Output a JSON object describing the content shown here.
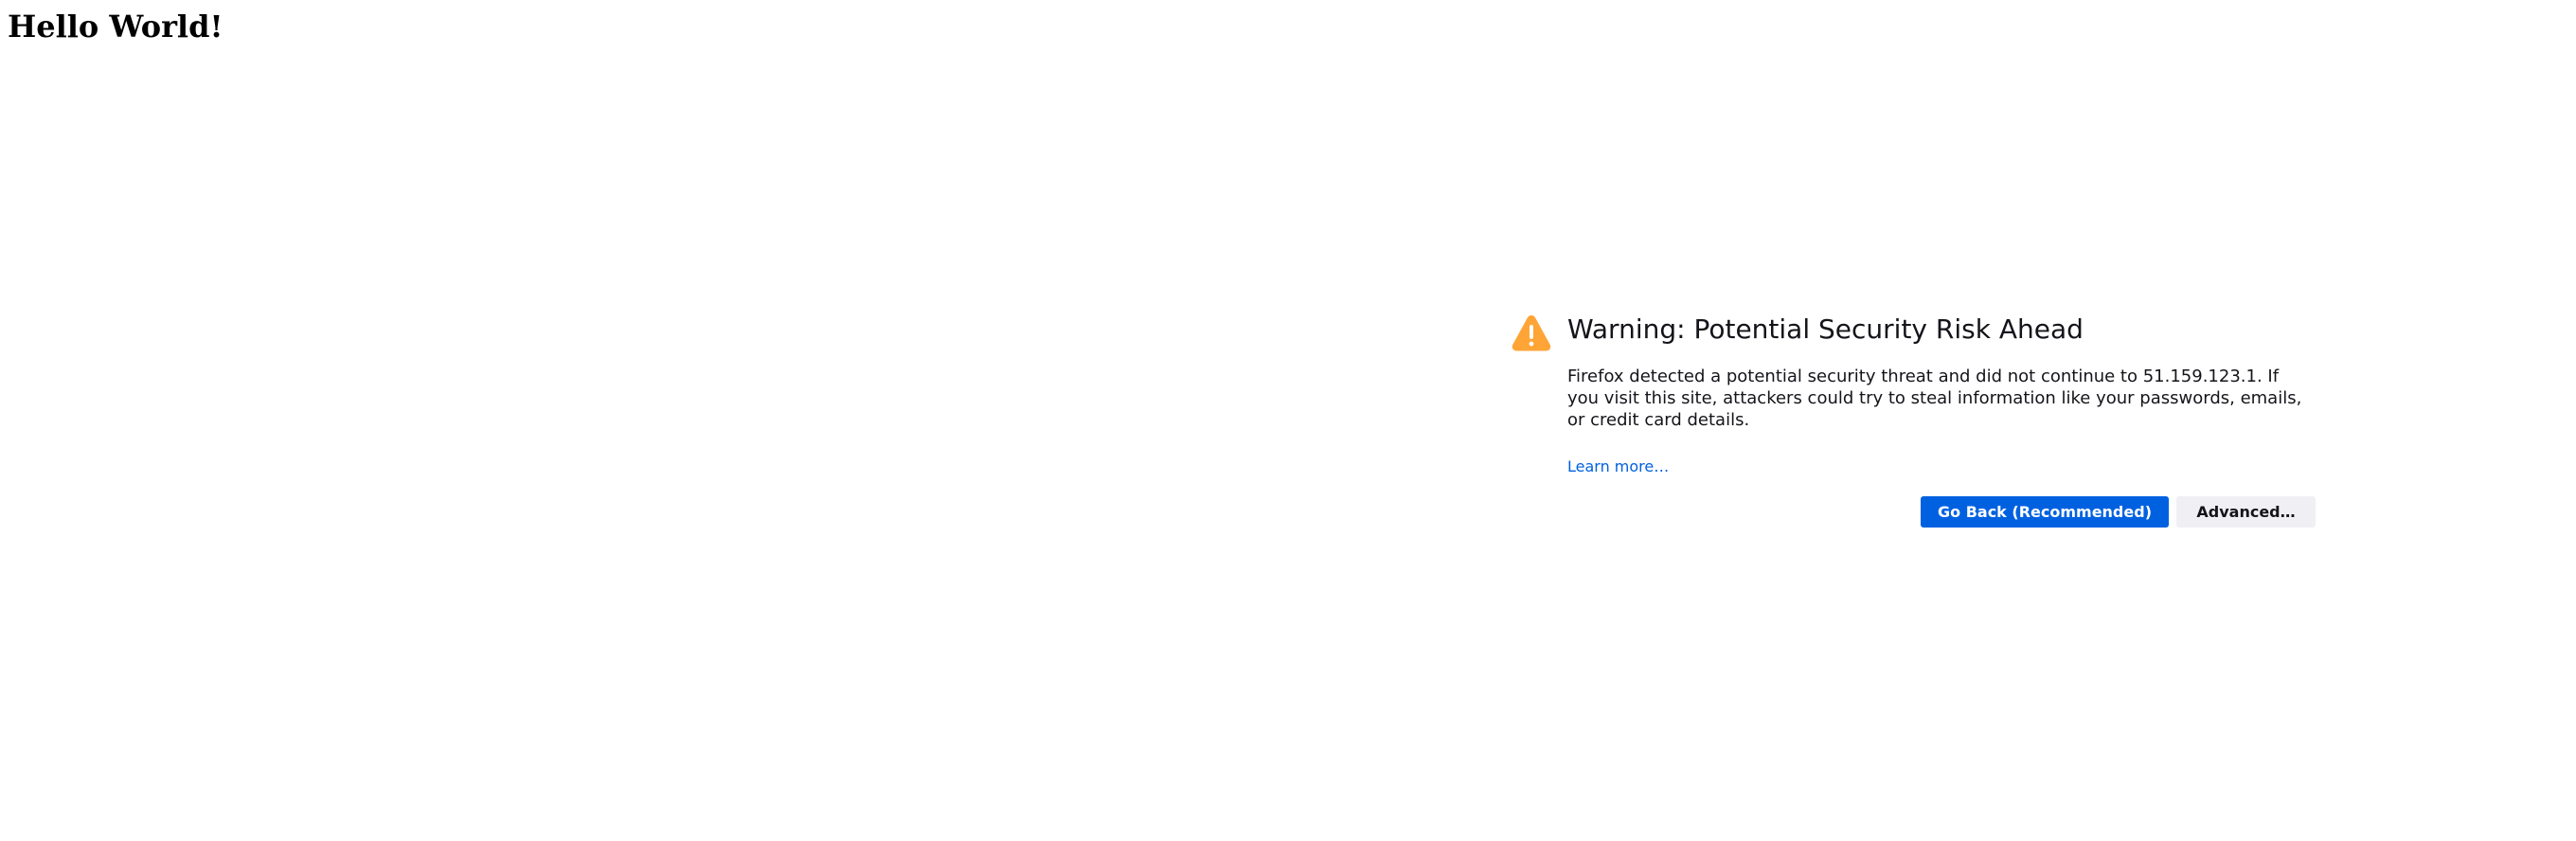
{
  "page": {
    "heading": "Hello World!"
  },
  "warning": {
    "icon": "warning-triangle-icon",
    "accent_color": "#ffa436",
    "title": "Warning: Potential Security Risk Ahead",
    "text": "Firefox detected a potential security threat and did not continue to 51.159.123.1. If you visit this site, attackers could try to steal information like your passwords, emails, or credit card details.",
    "learn_more": "Learn more…",
    "buttons": {
      "go_back": "Go Back (Recommended)",
      "advanced": "Advanced…"
    },
    "primary_color": "#0061e0"
  }
}
